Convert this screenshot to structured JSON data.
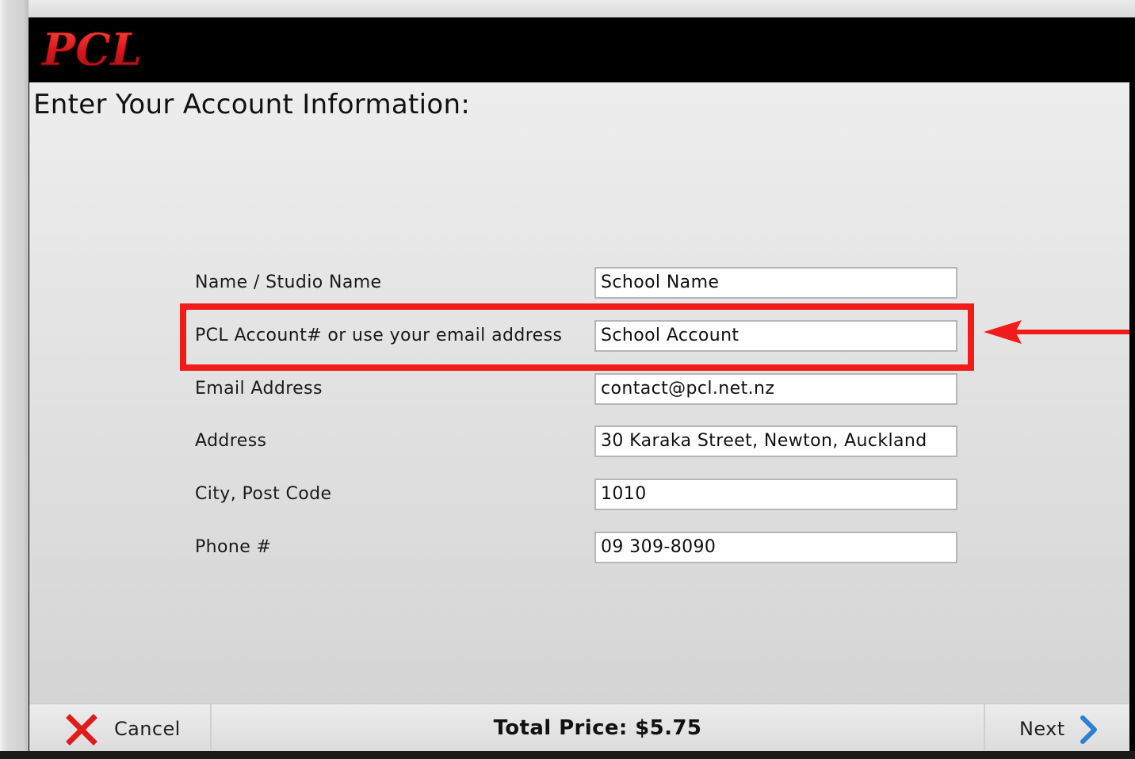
{
  "app": {
    "logo_text": "PCL",
    "page_title": "Enter Your Account Information:"
  },
  "form": {
    "fields": [
      {
        "label": "Name / Studio Name",
        "value": "School Name"
      },
      {
        "label": "PCL Account# or use your email address",
        "value": "School Account"
      },
      {
        "label": "Email Address",
        "value": "contact@pcl.net.nz"
      },
      {
        "label": "Address",
        "value": "30 Karaka Street, Newton, Auckland"
      },
      {
        "label": "City, Post Code",
        "value": "1010"
      },
      {
        "label": "Phone #",
        "value": "09 309-8090"
      }
    ]
  },
  "footer": {
    "cancel_label": "Cancel",
    "total_price": "Total Price: $5.75",
    "next_label": "Next"
  },
  "icons": {
    "cancel": "close-icon",
    "next": "chevron-right-icon"
  },
  "colors": {
    "brand_red": "#e3252b",
    "highlight": "#f01c1c",
    "next_blue": "#2f7fd6"
  }
}
